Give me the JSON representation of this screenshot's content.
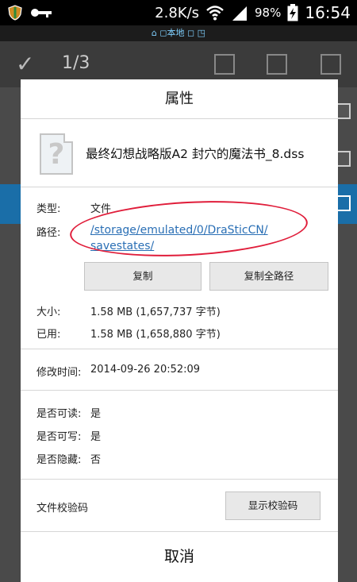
{
  "status_bar": {
    "net_speed": "2.8K/s",
    "battery": "98%",
    "time": "16:54"
  },
  "notification": {
    "text": "⌂ ◻本地 ◻ ◳"
  },
  "action_bar": {
    "check_glyph": "✓",
    "count": "1/3"
  },
  "dialog": {
    "title": "属性",
    "file_icon_glyph": "?",
    "file_name": "最终幻想战略版A2 封穴的魔法书_8.dss",
    "type_label": "类型:",
    "type_value": "文件",
    "path_label": "路径:",
    "path_line1": "/storage/emulated/0/DraSticCN/",
    "path_line2": "savestates/",
    "copy_button": "复制",
    "copy_full_button": "复制全路径",
    "size_label": "大小:",
    "size_value": "1.58 MB (1,657,737 字节)",
    "used_label": "已用:",
    "used_value": "1.58 MB (1,658,880 字节)",
    "modified_label": "修改时间:",
    "modified_value": "2014-09-26 20:52:09",
    "readable_label": "是否可读:",
    "readable_value": "是",
    "writable_label": "是否可写:",
    "writable_value": "是",
    "hidden_label": "是否隐藏:",
    "hidden_value": "否",
    "checksum_label": "文件校验码",
    "checksum_button": "显示校验码",
    "cancel_button": "取消"
  },
  "colors": {
    "link": "#2a6fb5",
    "annotation_circle": "#e01d3a",
    "selected_row": "#1a6ea8"
  }
}
